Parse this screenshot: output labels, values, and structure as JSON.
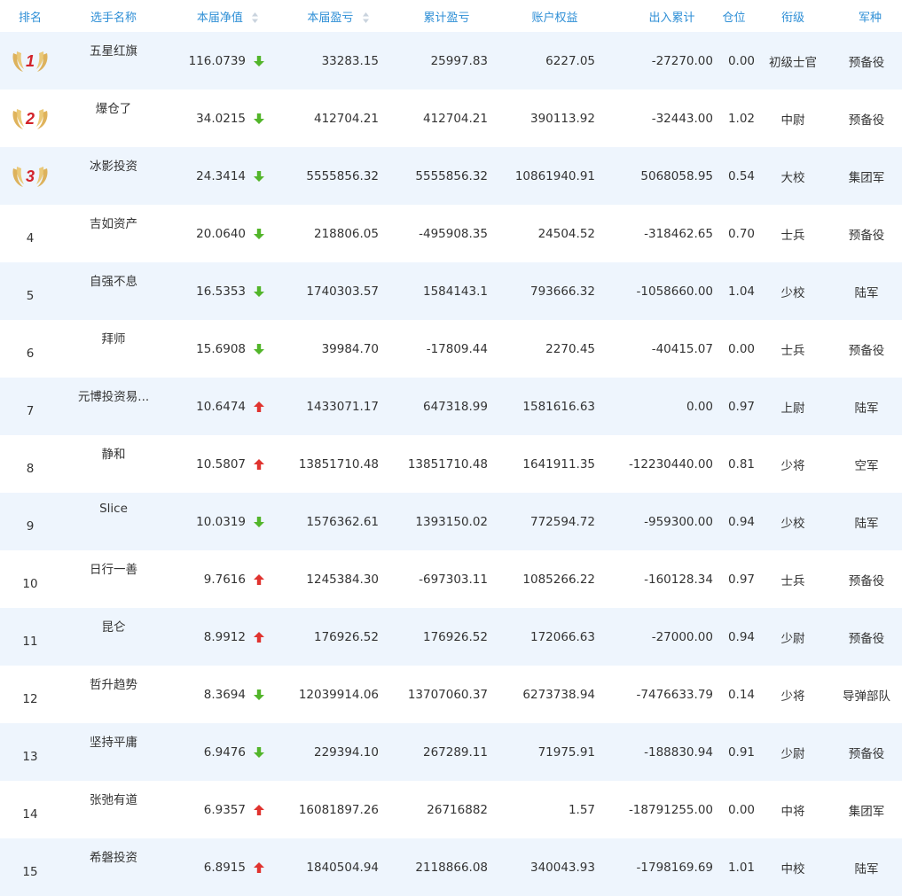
{
  "header": {
    "rank": "排名",
    "name": "选手名称",
    "nav": "本届净值",
    "pnl": "本届盈亏",
    "cum_pnl": "累计盈亏",
    "equity": "账户权益",
    "inout": "出入累计",
    "position": "仓位",
    "title": "衔级",
    "branch": "军种"
  },
  "colors": {
    "header_text": "#2f8fd6",
    "row_alt_bg": "#eef5fd",
    "up": "#e0332f",
    "down": "#52b52a",
    "medal_gold": "#d9a640",
    "medal_number": "#d2232a"
  },
  "rows": [
    {
      "rank": "1",
      "name": "五星红旗",
      "nav": "116.0739",
      "trend": "down",
      "pnl": "33283.15",
      "cum_pnl": "25997.83",
      "equity": "6227.05",
      "inout": "-27270.00",
      "position": "0.00",
      "title": "初级士官",
      "branch": "预备役"
    },
    {
      "rank": "2",
      "name": "爆仓了",
      "nav": "34.0215",
      "trend": "down",
      "pnl": "412704.21",
      "cum_pnl": "412704.21",
      "equity": "390113.92",
      "inout": "-32443.00",
      "position": "1.02",
      "title": "中尉",
      "branch": "预备役"
    },
    {
      "rank": "3",
      "name": "冰影投资",
      "nav": "24.3414",
      "trend": "down",
      "pnl": "5555856.32",
      "cum_pnl": "5555856.32",
      "equity": "10861940.91",
      "inout": "5068058.95",
      "position": "0.54",
      "title": "大校",
      "branch": "集团军"
    },
    {
      "rank": "4",
      "name": "吉如资产",
      "nav": "20.0640",
      "trend": "down",
      "pnl": "218806.05",
      "cum_pnl": "-495908.35",
      "equity": "24504.52",
      "inout": "-318462.65",
      "position": "0.70",
      "title": "士兵",
      "branch": "预备役"
    },
    {
      "rank": "5",
      "name": "自强不息",
      "nav": "16.5353",
      "trend": "down",
      "pnl": "1740303.57",
      "cum_pnl": "1584143.1",
      "equity": "793666.32",
      "inout": "-1058660.00",
      "position": "1.04",
      "title": "少校",
      "branch": "陆军"
    },
    {
      "rank": "6",
      "name": "拜师",
      "nav": "15.6908",
      "trend": "down",
      "pnl": "39984.70",
      "cum_pnl": "-17809.44",
      "equity": "2270.45",
      "inout": "-40415.07",
      "position": "0.00",
      "title": "士兵",
      "branch": "预备役"
    },
    {
      "rank": "7",
      "name": "元博投资易...",
      "nav": "10.6474",
      "trend": "up",
      "pnl": "1433071.17",
      "cum_pnl": "647318.99",
      "equity": "1581616.63",
      "inout": "0.00",
      "position": "0.97",
      "title": "上尉",
      "branch": "陆军"
    },
    {
      "rank": "8",
      "name": "静和",
      "nav": "10.5807",
      "trend": "up",
      "pnl": "13851710.48",
      "cum_pnl": "13851710.48",
      "equity": "1641911.35",
      "inout": "-12230440.00",
      "position": "0.81",
      "title": "少将",
      "branch": "空军"
    },
    {
      "rank": "9",
      "name": "Slice",
      "nav": "10.0319",
      "trend": "down",
      "pnl": "1576362.61",
      "cum_pnl": "1393150.02",
      "equity": "772594.72",
      "inout": "-959300.00",
      "position": "0.94",
      "title": "少校",
      "branch": "陆军"
    },
    {
      "rank": "10",
      "name": "日行一善",
      "nav": "9.7616",
      "trend": "up",
      "pnl": "1245384.30",
      "cum_pnl": "-697303.11",
      "equity": "1085266.22",
      "inout": "-160128.34",
      "position": "0.97",
      "title": "士兵",
      "branch": "预备役"
    },
    {
      "rank": "11",
      "name": "昆仑",
      "nav": "8.9912",
      "trend": "up",
      "pnl": "176926.52",
      "cum_pnl": "176926.52",
      "equity": "172066.63",
      "inout": "-27000.00",
      "position": "0.94",
      "title": "少尉",
      "branch": "预备役"
    },
    {
      "rank": "12",
      "name": "哲升趋势",
      "nav": "8.3694",
      "trend": "down",
      "pnl": "12039914.06",
      "cum_pnl": "13707060.37",
      "equity": "6273738.94",
      "inout": "-7476633.79",
      "position": "0.14",
      "title": "少将",
      "branch": "导弹部队"
    },
    {
      "rank": "13",
      "name": "坚持平庸",
      "nav": "6.9476",
      "trend": "down",
      "pnl": "229394.10",
      "cum_pnl": "267289.11",
      "equity": "71975.91",
      "inout": "-188830.94",
      "position": "0.91",
      "title": "少尉",
      "branch": "预备役"
    },
    {
      "rank": "14",
      "name": "张弛有道",
      "nav": "6.9357",
      "trend": "up",
      "pnl": "16081897.26",
      "cum_pnl": "26716882",
      "equity": "1.57",
      "inout": "-18791255.00",
      "position": "0.00",
      "title": "中将",
      "branch": "集团军"
    },
    {
      "rank": "15",
      "name": "希磐投资",
      "nav": "6.8915",
      "trend": "up",
      "pnl": "1840504.94",
      "cum_pnl": "2118866.08",
      "equity": "340043.93",
      "inout": "-1798169.69",
      "position": "1.01",
      "title": "中校",
      "branch": "陆军"
    }
  ]
}
